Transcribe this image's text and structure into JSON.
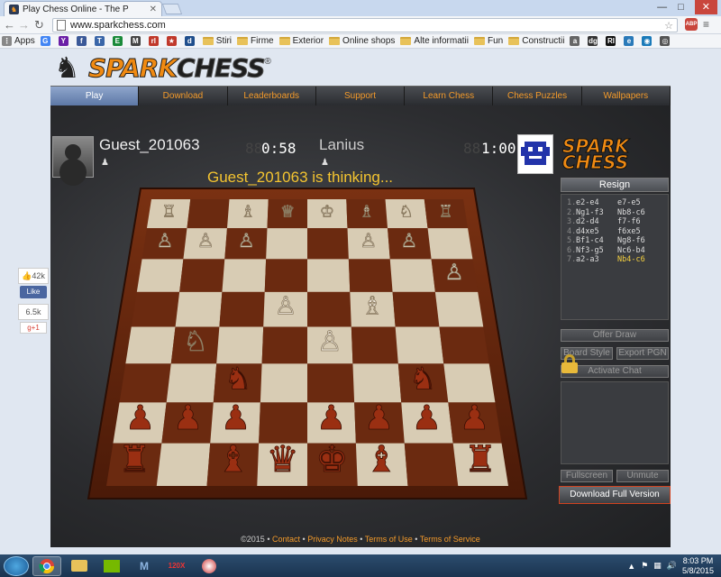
{
  "browser": {
    "tab_title": "Play Chess Online - The P",
    "tab_close": "✕",
    "url": "www.sparkchess.com",
    "abp": "ABP",
    "win": {
      "minimize": "—",
      "maximize": "□",
      "close": "✕"
    },
    "bookmarks": [
      {
        "label": "Apps",
        "color": "#888",
        "icon": "⋮",
        "type": "icon"
      },
      {
        "label": "",
        "color": "#4285f4",
        "icon": "G",
        "type": "icon"
      },
      {
        "label": "",
        "color": "#6b1fa6",
        "icon": "Y",
        "type": "icon"
      },
      {
        "label": "",
        "color": "#3b5998",
        "icon": "f",
        "type": "icon"
      },
      {
        "label": "",
        "color": "#3a66a8",
        "icon": "T",
        "type": "icon"
      },
      {
        "label": "",
        "color": "#1a8a3a",
        "icon": "E",
        "type": "icon"
      },
      {
        "label": "",
        "color": "#444",
        "icon": "M",
        "type": "icon"
      },
      {
        "label": "",
        "color": "#c0392b",
        "icon": "rl",
        "type": "icon"
      },
      {
        "label": "",
        "color": "#c0392b",
        "icon": "★",
        "type": "icon"
      },
      {
        "label": "",
        "color": "#1f4e8c",
        "icon": "d",
        "type": "icon"
      },
      {
        "label": "Stiri",
        "type": "folder"
      },
      {
        "label": "Firme",
        "type": "folder"
      },
      {
        "label": "Exterior",
        "type": "folder"
      },
      {
        "label": "Online shops",
        "type": "folder"
      },
      {
        "label": "Alte informatii",
        "type": "folder"
      },
      {
        "label": "Fun",
        "type": "folder"
      },
      {
        "label": "Constructii",
        "type": "folder"
      },
      {
        "label": "",
        "color": "#666",
        "icon": "a",
        "type": "icon"
      },
      {
        "label": "",
        "color": "#333",
        "icon": "dg",
        "type": "icon"
      },
      {
        "label": "",
        "color": "#111",
        "icon": "RI",
        "type": "icon"
      },
      {
        "label": "",
        "color": "#2a7ab9",
        "icon": "e",
        "type": "icon"
      },
      {
        "label": "",
        "color": "#1a7ab9",
        "icon": "◉",
        "type": "icon"
      },
      {
        "label": "",
        "color": "#555",
        "icon": "◎",
        "type": "icon"
      }
    ]
  },
  "site": {
    "logo_spark": "SPARK",
    "logo_chess": "CHESS",
    "logo_reg": "®",
    "nav": [
      "Play",
      "Download",
      "Leaderboards",
      "Support",
      "Learn Chess",
      "Chess Puzzles",
      "Wallpapers"
    ]
  },
  "game": {
    "player1": {
      "name": "Guest_201063",
      "clock": "0:58",
      "clock_bg": "88:"
    },
    "player2": {
      "name": "Lanius",
      "clock": "1:00",
      "clock_bg": "88"
    },
    "status": "Guest_201063 is thinking...",
    "buttons": {
      "resign": "Resign",
      "offer_draw": "Offer Draw",
      "board_style": "Board Style",
      "export_pgn": "Export PGN",
      "activate_chat": "Activate Chat",
      "fullscreen": "Fullscreen",
      "unmute": "Unmute",
      "download_full": "Download Full Version"
    },
    "moves": [
      {
        "n": "1.",
        "w": "e2-e4",
        "b": "e7-e5",
        "hl": false
      },
      {
        "n": "2.",
        "w": "Ng1-f3",
        "b": "Nb8-c6",
        "hl": false
      },
      {
        "n": "3.",
        "w": "d2-d4",
        "b": "f7-f6",
        "hl": false
      },
      {
        "n": "4.",
        "w": "d4xe5",
        "b": "f6xe5",
        "hl": false
      },
      {
        "n": "5.",
        "w": "Bf1-c4",
        "b": "Ng8-f6",
        "hl": false
      },
      {
        "n": "6.",
        "w": "Nf3-g5",
        "b": "Nc6-b4",
        "hl": false
      },
      {
        "n": "7.",
        "w": "a2-a3",
        "b": "Nb4-c6",
        "hl": true
      }
    ]
  },
  "footer": {
    "copyright": "©2015",
    "links": [
      "Contact",
      "Privacy Notes",
      "Terms of Use",
      "Terms of Service"
    ],
    "sep": "•"
  },
  "social": {
    "likes": "42k",
    "like_btn": "Like",
    "plus_count": "6.5k",
    "gplus": "g+1"
  },
  "taskbar": {
    "time": "8:03 PM",
    "date": "5/8/2015"
  }
}
